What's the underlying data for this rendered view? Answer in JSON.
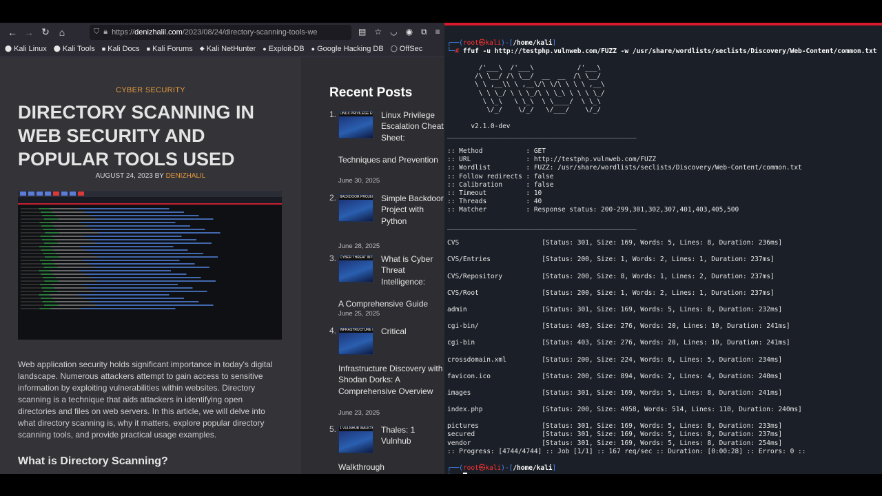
{
  "browser": {
    "url_prefix": "https://",
    "url_host": "denizhalil.com",
    "url_path": "/2023/08/24/directory-scanning-tools-we",
    "bookmarks": [
      "Kali Linux",
      "Kali Tools",
      "Kali Docs",
      "Kali Forums",
      "Kali NetHunter",
      "Exploit-DB",
      "Google Hacking DB",
      "OffSec"
    ]
  },
  "article": {
    "category": "CYBER SECURITY",
    "title": "DIRECTORY SCANNING IN WEB SECURITY AND POPULAR TOOLS USED",
    "date": "AUGUST 24, 2023",
    "by": "BY",
    "author": "DENIZHALIL",
    "intro": "Web application security holds significant importance in today's digital landscape. Numerous attackers attempt to gain access to sensitive information by exploiting vulnerabilities within websites. Directory scanning is a technique that aids attackers in identifying open directories and files on web servers. In this article, we will delve into what directory scanning is, why it matters, explore popular directory scanning tools, and provide practical usage examples.",
    "subheading": "What is Directory Scanning?"
  },
  "sidebar": {
    "title": "Recent Posts",
    "posts": [
      {
        "num": "1.",
        "title_a": "Linux Privilege Escalation Cheat Sheet:",
        "title_b": "Techniques and Prevention",
        "date": "June 30, 2025"
      },
      {
        "num": "2.",
        "title_a": "Simple Backdoor Project with Python",
        "title_b": "",
        "date": "June 28, 2025"
      },
      {
        "num": "3.",
        "title_a": "What is Cyber Threat Intelligence:",
        "title_b": "A Comprehensive Guide",
        "date": "June 25, 2025"
      },
      {
        "num": "4.",
        "title_a": "Critical",
        "title_b": "Infrastructure Discovery with Shodan Dorks: A Comprehensive Overview",
        "date": "June 23, 2025"
      },
      {
        "num": "5.",
        "title_a": "Thales: 1 Vulnhub",
        "title_b": "Walkthrough",
        "date": ""
      }
    ]
  },
  "terminal": {
    "prompt_user": "root㉿kali",
    "prompt_path": "/home/kali",
    "command": "ffuf -u http://testphp.vulnweb.com/FUZZ -w /usr/share/wordlists/seclists/Discovery/Web-Content/common.txt",
    "version": "v2.1.0-dev",
    "config": [
      ":: Method           : GET",
      ":: URL              : http://testphp.vulnweb.com/FUZZ",
      ":: Wordlist         : FUZZ: /usr/share/wordlists/seclists/Discovery/Web-Content/common.txt",
      ":: Follow redirects : false",
      ":: Calibration      : false",
      ":: Timeout          : 10",
      ":: Threads          : 40",
      ":: Matcher          : Response status: 200-299,301,302,307,401,403,405,500"
    ],
    "results": [
      "CVS                     [Status: 301, Size: 169, Words: 5, Lines: 8, Duration: 236ms]",
      "CVS/Entries             [Status: 200, Size: 1, Words: 2, Lines: 1, Duration: 237ms]",
      "CVS/Repository          [Status: 200, Size: 8, Words: 1, Lines: 2, Duration: 237ms]",
      "CVS/Root                [Status: 200, Size: 1, Words: 2, Lines: 1, Duration: 237ms]",
      "admin                   [Status: 301, Size: 169, Words: 5, Lines: 8, Duration: 232ms]",
      "cgi-bin/                [Status: 403, Size: 276, Words: 20, Lines: 10, Duration: 241ms]",
      "cgi-bin                 [Status: 403, Size: 276, Words: 20, Lines: 10, Duration: 241ms]",
      "crossdomain.xml         [Status: 200, Size: 224, Words: 8, Lines: 5, Duration: 234ms]",
      "favicon.ico             [Status: 200, Size: 894, Words: 2, Lines: 4, Duration: 240ms]",
      "images                  [Status: 301, Size: 169, Words: 5, Lines: 8, Duration: 241ms]",
      "index.php               [Status: 200, Size: 4958, Words: 514, Lines: 110, Duration: 240ms]",
      "pictures                [Status: 301, Size: 169, Words: 5, Lines: 8, Duration: 233ms]",
      "secured                 [Status: 301, Size: 169, Words: 5, Lines: 8, Duration: 237ms]",
      "vendor                  [Status: 301, Size: 169, Words: 5, Lines: 8, Duration: 254ms]"
    ],
    "progress": ":: Progress: [4744/4744] :: Job [1/1] :: 167 req/sec :: Duration: [0:00:28] :: Errors: 0 ::"
  }
}
